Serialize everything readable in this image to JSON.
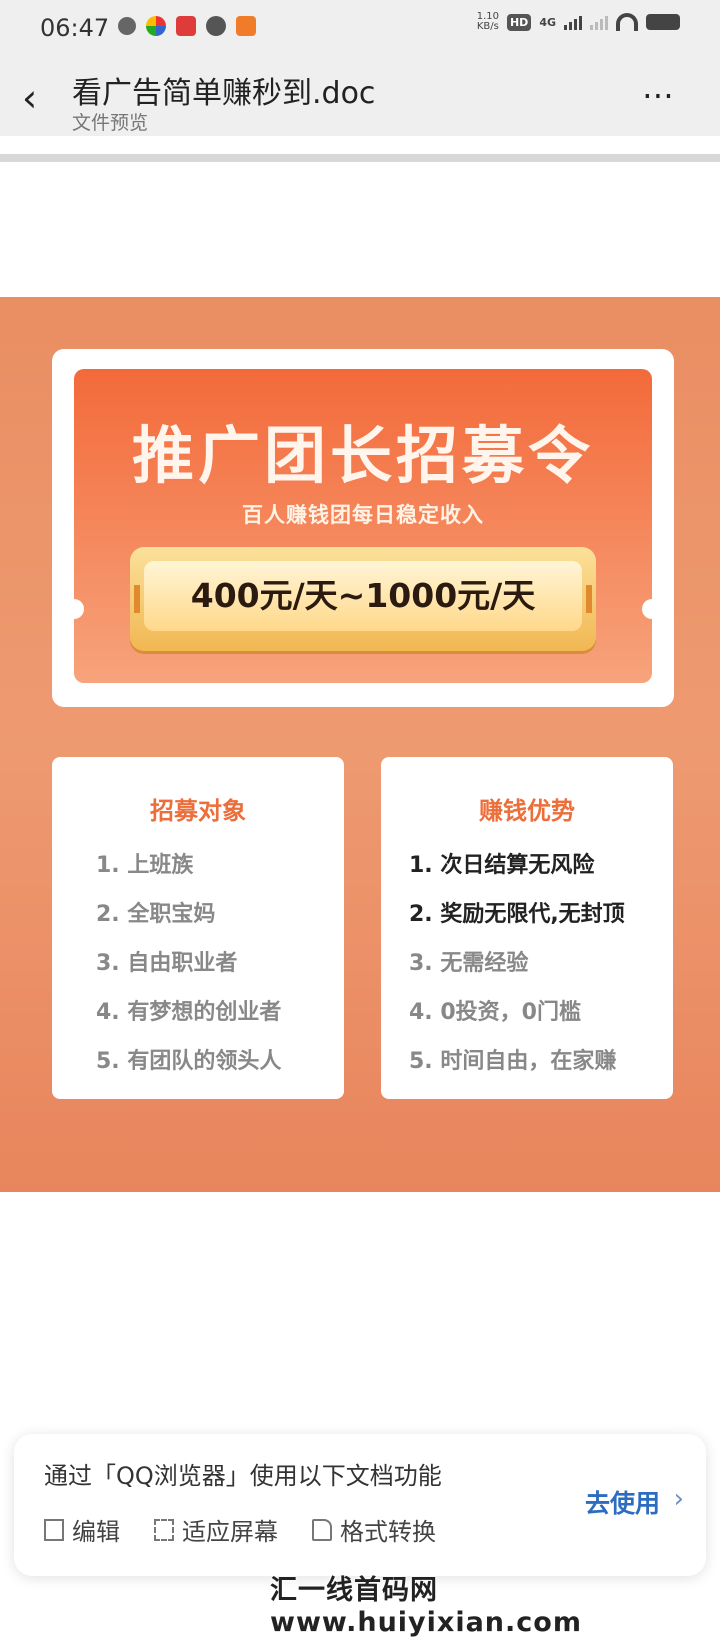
{
  "status_bar": {
    "time": "06:47",
    "net_speed": "1.10",
    "net_unit": "KB/s",
    "hd": "HD",
    "network": "4G"
  },
  "header": {
    "title": "看广告简单赚秒到.doc",
    "subtitle": "文件预览"
  },
  "poster": {
    "title": "推广团长招募令",
    "subtitle": "百人赚钱团每日稳定收入",
    "price": "400元/天~1000元/天",
    "left_card": {
      "heading": "招募对象",
      "items": [
        "1. 上班族",
        "2. 全职宝妈",
        "3. 自由职业者",
        "4. 有梦想的创业者",
        "5. 有团队的领头人"
      ]
    },
    "right_card": {
      "heading": "赚钱优势",
      "items": [
        "1. 次日结算无风险",
        "2. 奖励无限代,无封顶",
        "3. 无需经验",
        "4. 0投资，0门槛",
        "5. 时间自由，在家赚"
      ]
    }
  },
  "bottom_sheet": {
    "text": "通过「QQ浏览器」使用以下文档功能",
    "actions": [
      "编辑",
      "适应屏幕",
      "格式转换"
    ],
    "button": "去使用"
  },
  "watermark": "汇一线首码网 www.huiyixian.com"
}
